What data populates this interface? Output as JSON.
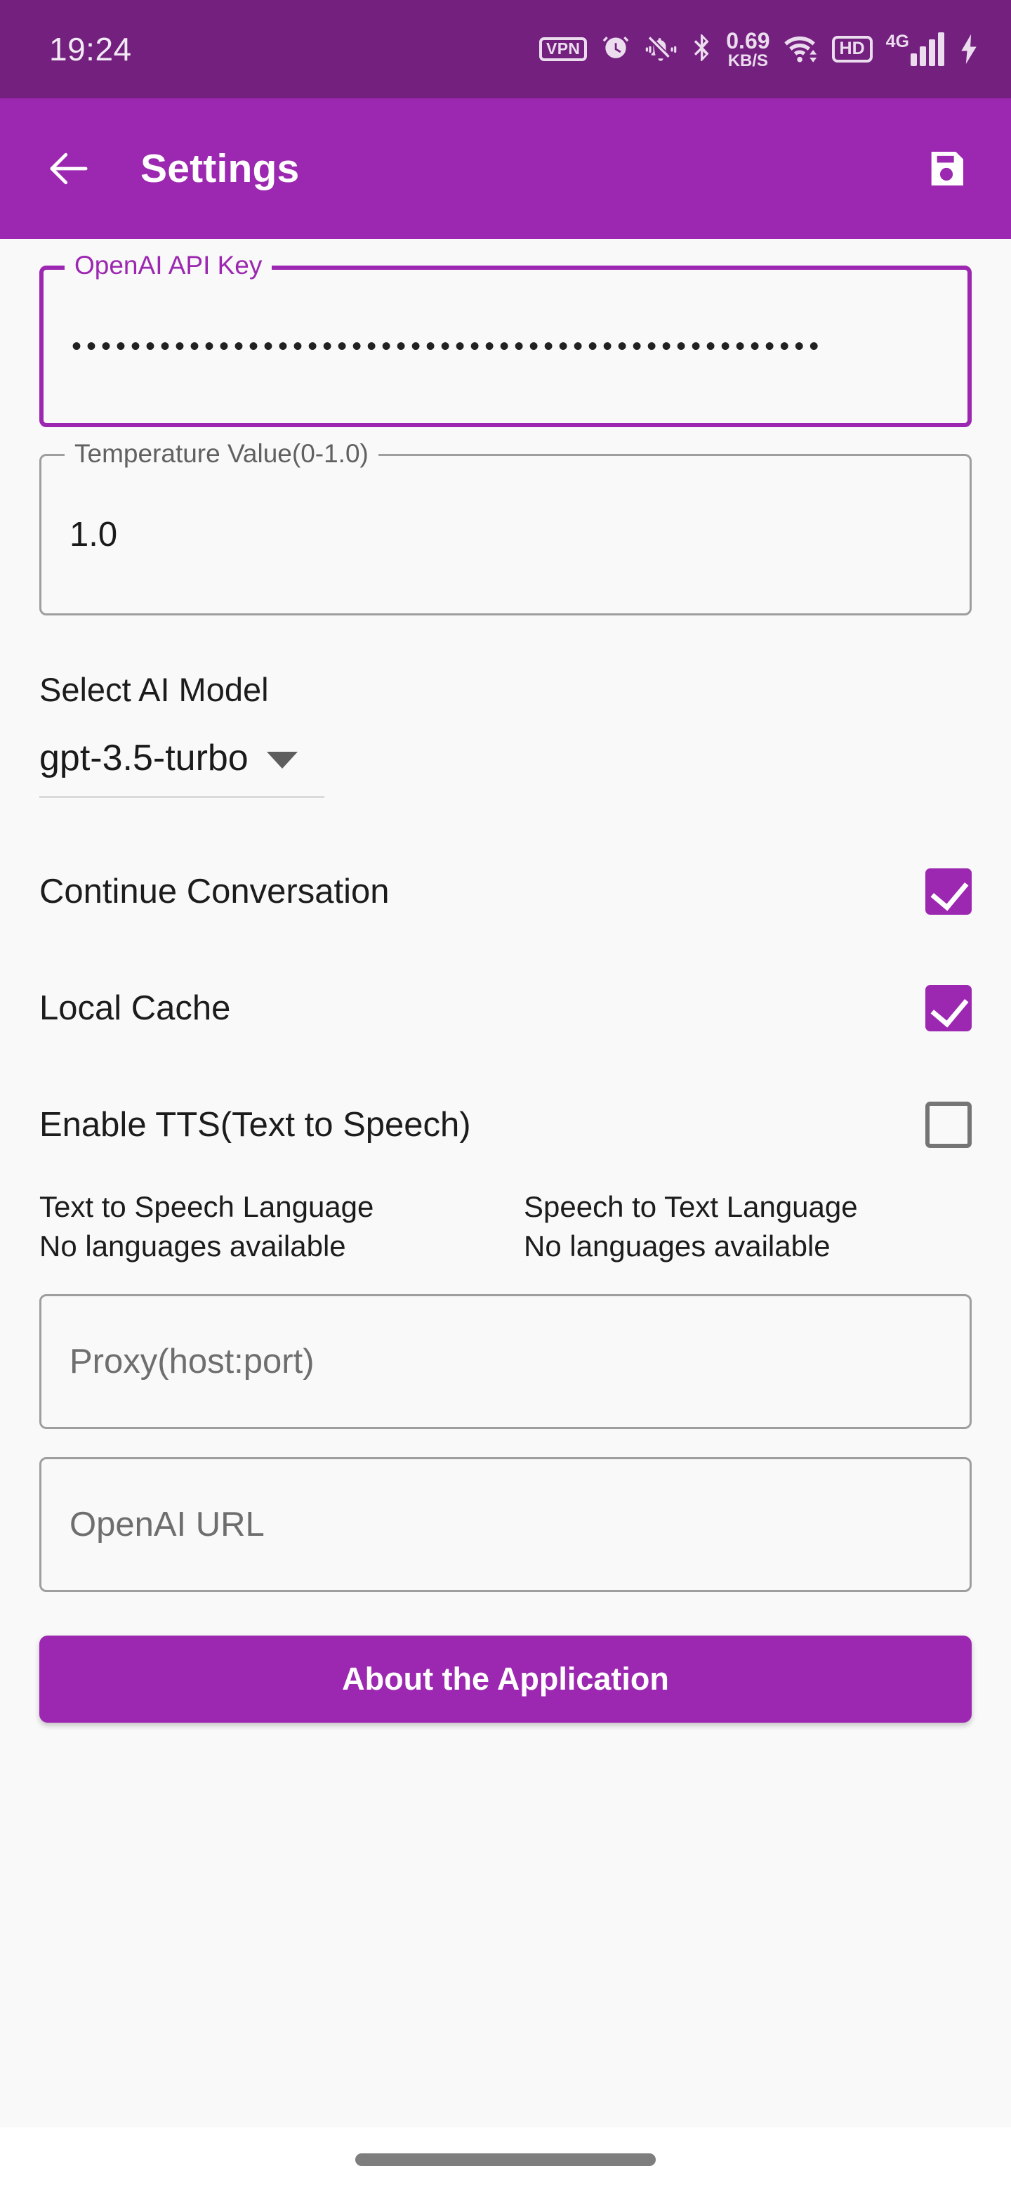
{
  "status_bar": {
    "clock": "19:24",
    "icons": [
      {
        "name": "vpn-badge-icon",
        "label": "VPN"
      },
      {
        "name": "alarm-clock-icon",
        "label": ""
      },
      {
        "name": "bell-muted-icon",
        "label": ""
      },
      {
        "name": "bluetooth-icon",
        "label": ""
      },
      {
        "name": "network-speed-indicator",
        "label": "0.69 KB/S"
      },
      {
        "name": "wifi-icon",
        "label": ""
      },
      {
        "name": "hd-badge-icon",
        "label": "HD"
      },
      {
        "name": "cellular-signal-icon",
        "label": "4G"
      },
      {
        "name": "battery-charging-icon",
        "label": ""
      }
    ],
    "network_speed_value": "0.69",
    "network_speed_unit": "KB/S",
    "vpn_label": "VPN",
    "hd_label": "HD",
    "signal_generation": "4G",
    "background_color": "#73207E"
  },
  "app_bar": {
    "back_icon": "arrow-left-icon",
    "title": "Settings",
    "save_icon": "save-floppy-icon",
    "background_color": "#9C27B0"
  },
  "form": {
    "api_key": {
      "label": "OpenAI API Key",
      "value": "•••••••••••••••••••••••••••••••••••••••••••••••••••",
      "focused": true,
      "accent_color": "#9C27B0"
    },
    "temperature": {
      "label": "Temperature Value(0-1.0)",
      "value": "1.0"
    },
    "model": {
      "label": "Select AI Model",
      "selected": "gpt-3.5-turbo",
      "chevron_icon": "chevron-down-icon"
    },
    "toggles": [
      {
        "label": "Continue Conversation",
        "checked": true
      },
      {
        "label": "Local Cache",
        "checked": true
      },
      {
        "label": "Enable TTS(Text to Speech)",
        "checked": false
      }
    ],
    "languages": [
      {
        "title": "Text to Speech Language",
        "status": "No languages available"
      },
      {
        "title": "Speech to Text Language",
        "status": "No languages available"
      }
    ],
    "proxy": {
      "placeholder": "Proxy(host:port)",
      "value": ""
    },
    "openai_url": {
      "placeholder": "OpenAI URL",
      "value": ""
    },
    "about_button": {
      "label": "About the Application",
      "background_color": "#9C27B0"
    }
  },
  "nav_bar": {
    "gesture_pill": "home-gesture-pill"
  }
}
